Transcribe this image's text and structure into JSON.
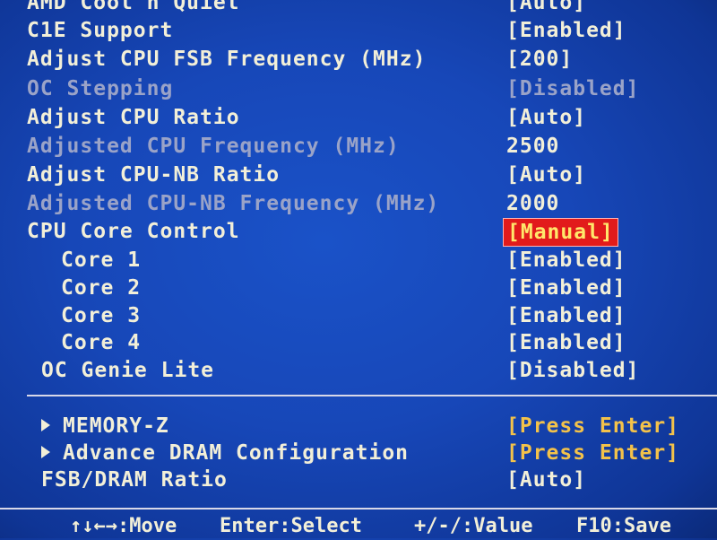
{
  "rows_top": [
    {
      "label": "AMD Cool'n'Quiet",
      "value": "[Auto]",
      "enabled": true
    },
    {
      "label": "C1E Support",
      "value": "[Enabled]",
      "enabled": true
    },
    {
      "label": "Adjust CPU FSB Frequency (MHz)",
      "value": "[200]",
      "enabled": true
    },
    {
      "label": "OC Stepping",
      "value": "[Disabled]",
      "enabled": false
    },
    {
      "label": "Adjust CPU Ratio",
      "value": "[Auto]",
      "enabled": true
    },
    {
      "label": "Adjusted CPU Frequency (MHz)",
      "value": "2500",
      "enabled": false
    },
    {
      "label": "Adjust CPU-NB Ratio",
      "value": "[Auto]",
      "enabled": true
    },
    {
      "label": "Adjusted CPU-NB Frequency (MHz)",
      "value": "2000",
      "enabled": false
    },
    {
      "label": "CPU Core Control",
      "value": "[Manual]",
      "enabled": true,
      "selected": true
    },
    {
      "label": "Core 1",
      "value": "[Enabled]",
      "enabled": true
    },
    {
      "label": "Core 2",
      "value": "[Enabled]",
      "enabled": true
    },
    {
      "label": "Core 3",
      "value": "[Enabled]",
      "enabled": true
    },
    {
      "label": "Core 4",
      "value": "[Enabled]",
      "enabled": true
    },
    {
      "label": "OC Genie Lite",
      "value": "[Disabled]",
      "enabled": true
    }
  ],
  "rows_bottom": [
    {
      "label": "MEMORY-Z",
      "value": "[Press Enter]",
      "submenu": true
    },
    {
      "label": "Advance DRAM Configuration",
      "value": "[Press Enter]",
      "submenu": true
    },
    {
      "label": "FSB/DRAM Ratio",
      "value": "[Auto]",
      "submenu": false
    }
  ],
  "footer": {
    "move": "↑↓←→:Move",
    "select": "Enter:Select",
    "value": "+/-/:Value",
    "save": "F10:Save"
  },
  "colors": {
    "background": "#1747b8",
    "text": "#f2efd8",
    "disabled_text": "#9aa3c8",
    "highlight_bg": "#e21b1b",
    "highlight_text": "#ffe86b",
    "submenu_value": "#f3c24a"
  }
}
